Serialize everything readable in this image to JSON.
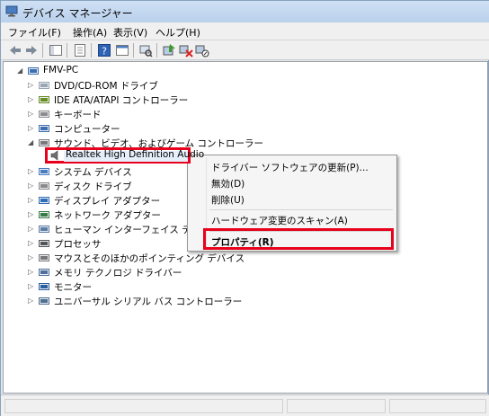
{
  "window": {
    "title": "デバイス マネージャー"
  },
  "menu": {
    "items": [
      {
        "label": "ファイル(F)"
      },
      {
        "label": "操作(A)"
      },
      {
        "label": "表示(V)"
      },
      {
        "label": "ヘルプ(H)"
      }
    ]
  },
  "tree": {
    "root": "FMV-PC",
    "items": [
      {
        "label": "DVD/CD-ROM ドライブ",
        "icon": "dvd-drive-icon"
      },
      {
        "label": "IDE ATA/ATAPI コントローラー",
        "icon": "ide-controller-icon"
      },
      {
        "label": "キーボード",
        "icon": "keyboard-icon"
      },
      {
        "label": "コンピューター",
        "icon": "computer-icon"
      },
      {
        "label": "サウンド、ビデオ、およびゲーム コントローラー",
        "icon": "sound-icon",
        "expanded": true
      },
      {
        "label": "Realtek High Definition Audio",
        "icon": "speaker-icon",
        "child": true
      },
      {
        "label": "システム デバイス",
        "icon": "system-device-icon"
      },
      {
        "label": "ディスク ドライブ",
        "icon": "disk-drive-icon"
      },
      {
        "label": "ディスプレイ アダプター",
        "icon": "display-adapter-icon"
      },
      {
        "label": "ネットワーク アダプター",
        "icon": "network-adapter-icon"
      },
      {
        "label": "ヒューマン インターフェイス デバイス",
        "icon": "hid-icon"
      },
      {
        "label": "プロセッサ",
        "icon": "processor-icon"
      },
      {
        "label": "マウスとそのほかのポインティング デバイス",
        "icon": "mouse-icon"
      },
      {
        "label": "メモリ テクノロジ ドライバー",
        "icon": "memory-icon"
      },
      {
        "label": "モニター",
        "icon": "monitor-icon"
      },
      {
        "label": "ユニバーサル シリアル バス コントローラー",
        "icon": "usb-icon"
      }
    ]
  },
  "context_menu": {
    "update_driver": "ドライバー ソフトウェアの更新(P)...",
    "disable": "無効(D)",
    "uninstall": "削除(U)",
    "scan_hardware": "ハードウェア変更のスキャン(A)",
    "properties": "プロパティ(R)"
  },
  "colors": {
    "highlight_border": "#e8001c",
    "selection": "#e5eef9"
  }
}
